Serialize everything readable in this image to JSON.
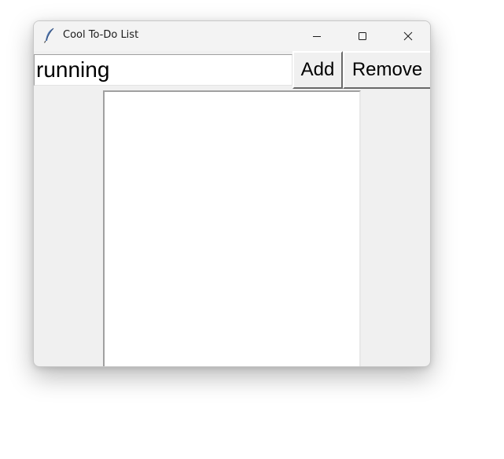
{
  "window": {
    "title": "Cool To-Do List",
    "icon": "feather-icon"
  },
  "controls": {
    "minimize_icon": "minimize-icon",
    "maximize_icon": "maximize-icon",
    "close_icon": "close-icon"
  },
  "entry": {
    "value": "running"
  },
  "buttons": {
    "add_label": "Add",
    "remove_label": "Remove"
  },
  "listbox": {
    "items": []
  },
  "colors": {
    "window_bg": "#f0f0f0",
    "titlebar_bg": "#f3f3f3",
    "listbox_bg": "#ffffff"
  }
}
